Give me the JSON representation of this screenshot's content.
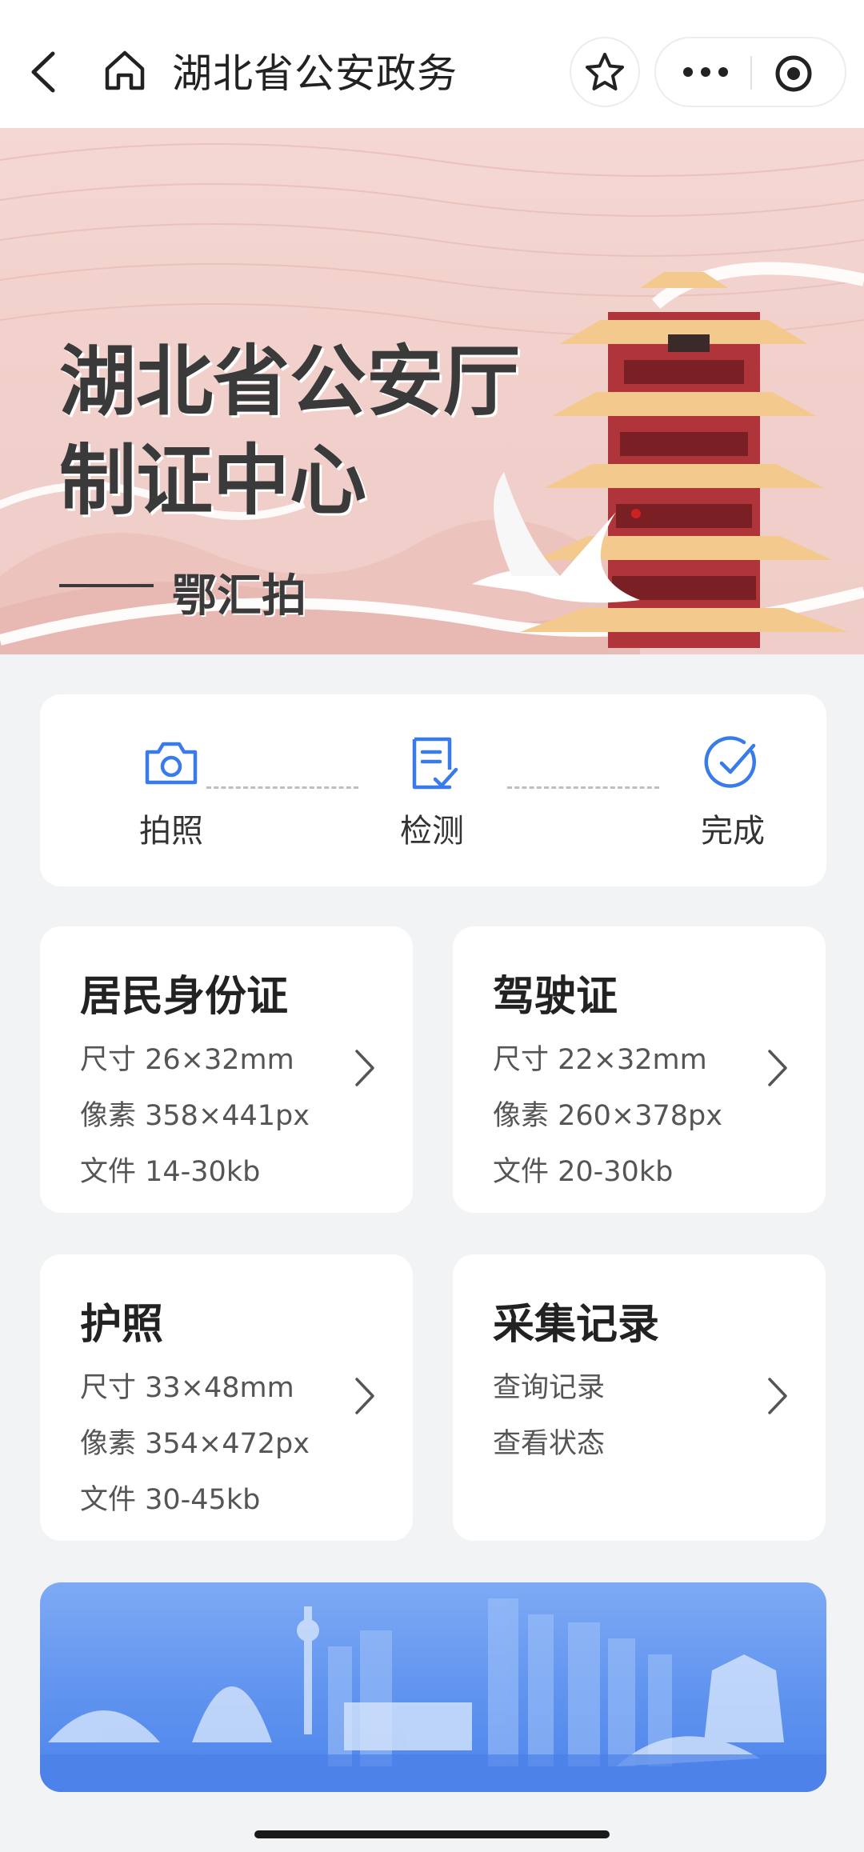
{
  "nav": {
    "title": "湖北省公安政务"
  },
  "banner": {
    "title_line1": "湖北省公安厅",
    "title_line2": "制证中心",
    "subtitle": "鄂汇拍"
  },
  "steps": [
    {
      "label": "拍照",
      "icon": "camera-icon"
    },
    {
      "label": "检测",
      "icon": "check-document-icon"
    },
    {
      "label": "完成",
      "icon": "check-circle-icon"
    }
  ],
  "cards": {
    "id_card": {
      "title": "居民身份证",
      "size": "尺寸 26×32mm",
      "pixels": "像素 358×441px",
      "file": "文件 14-30kb"
    },
    "driver_license": {
      "title": "驾驶证",
      "size": "尺寸 22×32mm",
      "pixels": "像素 260×378px",
      "file": "文件 20-30kb"
    },
    "passport": {
      "title": "护照",
      "size": "尺寸 33×48mm",
      "pixels": "像素 354×472px",
      "file": "文件 30-45kb"
    },
    "records": {
      "title": "采集记录",
      "query": "查询记录",
      "status": "查看状态"
    }
  },
  "colors": {
    "accent": "#3a7bea",
    "banner_bg": "#f3d3cf",
    "page_bg": "#f2f3f5"
  }
}
